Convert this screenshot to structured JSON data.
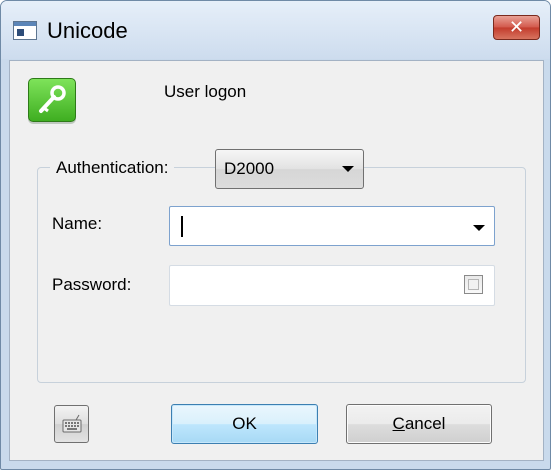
{
  "window": {
    "title": "Unicode",
    "close_glyph": "✕",
    "title_icon": "application-window-icon"
  },
  "logon": {
    "icon": "key-icon",
    "label": "User logon"
  },
  "form": {
    "authentication_label": "Authentication:",
    "authentication_value": "D2000",
    "name_label": "Name:",
    "name_value": "",
    "password_label": "Password:",
    "password_value": ""
  },
  "buttons": {
    "keyboard_icon": "keyboard-icon",
    "ok_label": "OK",
    "cancel_first": "C",
    "cancel_rest": "ancel"
  },
  "colors": {
    "accent": "#3c7fb1",
    "close": "#c23b2c",
    "icon_green": "#3fae21"
  }
}
